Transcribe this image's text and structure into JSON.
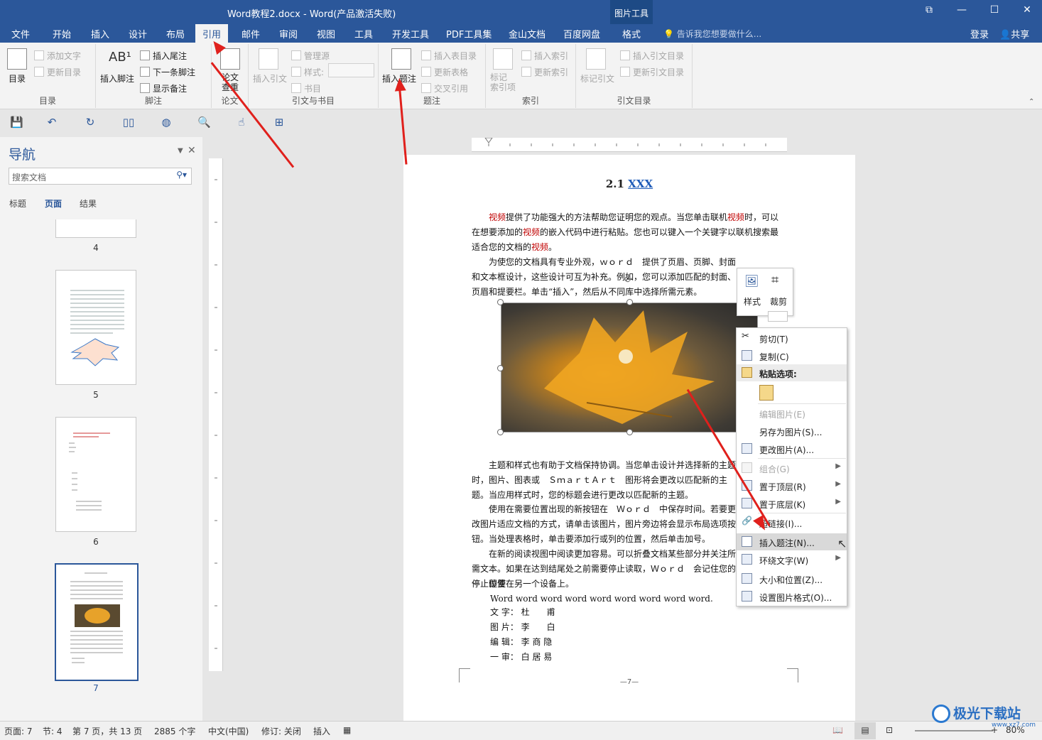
{
  "window": {
    "title": "Word教程2.docx - Word(产品激活失败)",
    "tool_tab": "图片工具",
    "controls": [
      "⧉",
      "—",
      "☐",
      "✕"
    ]
  },
  "tabs": [
    "文件",
    "开始",
    "插入",
    "设计",
    "布局",
    "引用",
    "邮件",
    "审阅",
    "视图",
    "工具",
    "开发工具",
    "PDF工具集",
    "金山文档",
    "百度网盘",
    "格式"
  ],
  "active_tab": "引用",
  "tell_me": "告诉我您想要做什么...",
  "account": {
    "login": "登录",
    "share": "共享"
  },
  "ribbon": {
    "toc": {
      "big": "目录",
      "add_text": "添加文字",
      "update": "更新目录",
      "group": "目录"
    },
    "footnote": {
      "big": "插入脚注",
      "endnote": "插入尾注",
      "next": "下一条脚注",
      "show": "显示备注",
      "group": "脚注"
    },
    "paper": {
      "big": "论文\n查重",
      "group": "论文"
    },
    "citation": {
      "big": "插入引文",
      "manage": "管理源",
      "style": "样式:",
      "biblio": "书目",
      "group": "引文与书目"
    },
    "caption": {
      "big": "插入题注",
      "table_toc": "插入表目录",
      "update_table": "更新表格",
      "cross_ref": "交叉引用",
      "group": "题注"
    },
    "index": {
      "big": "标记\n索引项",
      "insert": "插入索引",
      "update": "更新索引",
      "group": "索引"
    },
    "toa": {
      "big": "标记引文",
      "insert": "插入引文目录",
      "update": "更新引文目录",
      "group": "引文目录"
    }
  },
  "nav": {
    "title": "导航",
    "search_placeholder": "搜索文档",
    "tabs": [
      "标题",
      "页面",
      "结果"
    ],
    "active_tab": "页面",
    "pages": [
      "4",
      "5",
      "6",
      "7"
    ]
  },
  "document": {
    "heading_num": "2.1",
    "heading_link": "XXX",
    "p1": [
      "视频",
      "提供了功能强大的方法帮助您证明您的观点。当您单击联机",
      "视频",
      "时，可以在想要添加的",
      "视频",
      "的嵌入代码中进行粘贴。您也可以键入一个关键字以联机搜索最适合您的文档的",
      "视频",
      "。"
    ],
    "p2": "为使您的文档具有专业外观，ｗｏｒｄ　提供了页眉、页脚、封面和文本框设计，这些设计可互为补充。例如，您可以添加匹配的封面、页眉和提要栏。单击“插入”，然后从不同库中选择所需元素。",
    "p3": "主题和样式也有助于文档保持协调。当您单击设计并选择新的主题时，图片、图表或　ＳｍａｒｔＡｒｔ　图形将会更改以匹配新的主题。当应用样式时，您的标题会进行更改以匹配新的主题。",
    "p4": "使用在需要位置出现的新按钮在　Ｗｏｒｄ　中保存时间。若要更改图片适应文档的方式，请单击该图片，图片旁边将会显示布局选项按钮。当处理表格时，单击要添加行或列的位置，然后单击加号。",
    "p5": "在新的阅读视图中阅读更加容易。可以折叠文档某些部分并关注所需文本。如果在达到结尾处之前需要停止读取，Ｗｏｒｄ　会记住您的停止位置",
    "p5b": "－　即使在另一个设备上。",
    "p6": "Word word word word word word word word word.",
    "credits": [
      "文 字： 杜　　甫",
      "图 片： 李　　白",
      "编 辑： 李 商 隐",
      "一 审： 白 居 易"
    ],
    "page_footer": "—7—"
  },
  "mini_toolbar": [
    "样式",
    "裁剪"
  ],
  "context_menu": [
    {
      "label": "剪切(T)",
      "state": "normal"
    },
    {
      "label": "复制(C)",
      "state": "normal"
    },
    {
      "label": "粘贴选项:",
      "state": "head"
    },
    {
      "label": "编辑图片(E)",
      "state": "disabled"
    },
    {
      "label": "另存为图片(S)...",
      "state": "normal"
    },
    {
      "label": "更改图片(A)...",
      "state": "normal"
    },
    {
      "label": "组合(G)",
      "state": "disabled"
    },
    {
      "label": "置于顶层(R)",
      "state": "normal"
    },
    {
      "label": "置于底层(K)",
      "state": "normal"
    },
    {
      "label": "超链接(I)...",
      "state": "normal"
    },
    {
      "label": "插入题注(N)...",
      "state": "highlighted"
    },
    {
      "label": "环绕文字(W)",
      "state": "normal"
    },
    {
      "label": "大小和位置(Z)...",
      "state": "normal"
    },
    {
      "label": "设置图片格式(O)...",
      "state": "normal"
    }
  ],
  "status": {
    "page": "页面: 7",
    "section": "节: 4",
    "page_of": "第 7 页，共 13 页",
    "words": "2885 个字",
    "lang": "中文(中国)",
    "revision": "修订: 关闭",
    "mode": "插入",
    "zoom": "80%"
  },
  "watermark": "极光下载站",
  "watermark_url": "www.xz7.com",
  "colors": {
    "word_blue": "#2b579a",
    "arrow_red": "#e0201c",
    "highlight": "#d9d9d9"
  }
}
